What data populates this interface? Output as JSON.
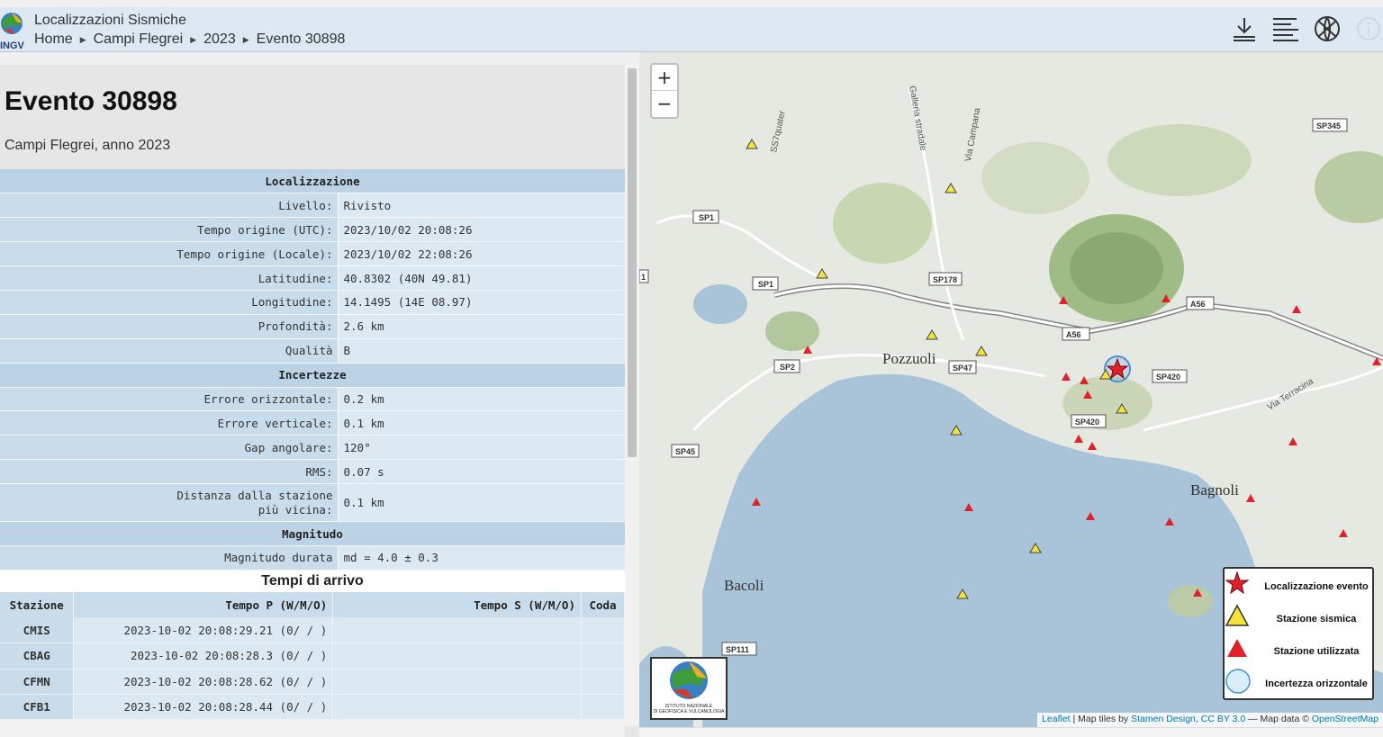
{
  "header": {
    "app_title": "Localizzazioni Sismiche",
    "logo_text": "INGV",
    "breadcrumb": [
      "Home",
      "Campi Flegrei",
      "2023",
      "Evento 30898"
    ],
    "icons": [
      "download-icon",
      "list-icon",
      "globe-icon",
      "info-icon"
    ]
  },
  "event": {
    "title": "Evento 30898",
    "subtitle": "Campi Flegrei, anno 2023"
  },
  "sections": {
    "localizzazione": "Localizzazione",
    "incertezze": "Incertezze",
    "magnitudo": "Magnitudo"
  },
  "localizzazione": [
    {
      "label": "Livello:",
      "value": "Rivisto"
    },
    {
      "label": "Tempo origine (UTC):",
      "value": "2023/10/02 20:08:26"
    },
    {
      "label": "Tempo origine (Locale):",
      "value": "2023/10/02 22:08:26"
    },
    {
      "label": "Latitudine:",
      "value": "40.8302 (40N 49.81)"
    },
    {
      "label": "Longitudine:",
      "value": "14.1495 (14E 08.97)"
    },
    {
      "label": "Profondità:",
      "value": "2.6 km"
    },
    {
      "label": "Qualità",
      "value": "B"
    }
  ],
  "incertezze": [
    {
      "label": "Errore orizzontale:",
      "value": "0.2 km"
    },
    {
      "label": "Errore verticale:",
      "value": "0.1 km"
    },
    {
      "label": "Gap angolare:",
      "value": "120°"
    },
    {
      "label": "RMS:",
      "value": "0.07 s"
    },
    {
      "label_line1": "Distanza dalla stazione",
      "label_line2": "più vicina:",
      "value": "0.1 km"
    }
  ],
  "magnitudo": [
    {
      "label": "Magnitudo durata",
      "value": "md = 4.0 ± 0.3"
    }
  ],
  "arrivi": {
    "title": "Tempi di arrivo",
    "columns": [
      "Stazione",
      "Tempo P (W/M/O)",
      "Tempo S (W/M/O)",
      "Coda"
    ],
    "rows": [
      {
        "station": "CMIS",
        "p": "2023-10-02 20:08:29.21 (0/ / )",
        "s": "",
        "coda": ""
      },
      {
        "station": "CBAG",
        "p": "2023-10-02 20:08:28.3 (0/ / )",
        "s": "",
        "coda": ""
      },
      {
        "station": "CFMN",
        "p": "2023-10-02 20:08:28.62 (0/ / )",
        "s": "",
        "coda": ""
      },
      {
        "station": "CFB1",
        "p": "2023-10-02 20:08:28.44 (0/ / )",
        "s": "",
        "coda": ""
      }
    ]
  },
  "map": {
    "zoom_in": "+",
    "zoom_out": "−",
    "places": [
      "Pozzuoli",
      "Bagnoli",
      "Bacoli"
    ],
    "road_labels": [
      "SP1",
      "SP1",
      "SP2",
      "SP178",
      "SP47",
      "SP420",
      "SP420",
      "SP45",
      "SP111",
      "SP345",
      "A56",
      "A56"
    ],
    "street_labels": [
      "Galleria stradale",
      "Via Campana",
      "SS7quater",
      "Via Terracina"
    ],
    "edge_label": "1",
    "legend": [
      {
        "icon": "red-star-icon",
        "label": "Localizzazione evento"
      },
      {
        "icon": "yellow-triangle-icon",
        "label": "Stazione sismica"
      },
      {
        "icon": "red-triangle-icon",
        "label": "Stazione utilizzata"
      },
      {
        "icon": "blue-circle-icon",
        "label": "Incertezza orizzontale"
      }
    ],
    "ingv_logo_text": [
      "ISTITUTO NAZIONALE",
      "DI GEOFISICA E VULCANOLOGIA"
    ],
    "attribution": {
      "leaflet": "Leaflet",
      "sep1": " | Map tiles by ",
      "stamen": "Stamen Design",
      "sep2": ", ",
      "cc": "CC BY 3.0",
      "sep3": " — Map data © ",
      "osm": "OpenStreetMap"
    },
    "colors": {
      "star": "#e0202a",
      "station": "#f5e23a",
      "used": "#e0202a",
      "uncertainty": "#4a90d9",
      "sea": "#a9c3d8"
    }
  }
}
